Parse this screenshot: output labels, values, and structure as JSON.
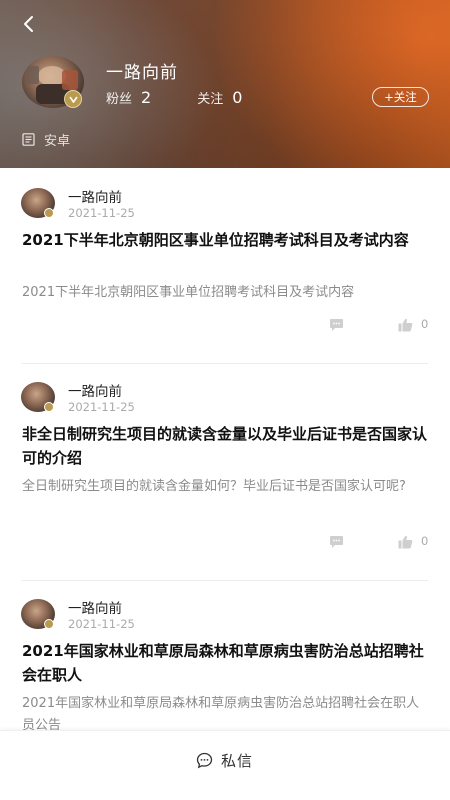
{
  "profile": {
    "name": "一路向前",
    "fans_label": "粉丝",
    "fans_count": "2",
    "following_label": "关注",
    "following_count": "0",
    "follow_button": "+关注",
    "platform": "安卓"
  },
  "posts": [
    {
      "author": "一路向前",
      "date": "2021-11-25",
      "title": "2021下半年北京朝阳区事业单位招聘考试科目及考试内容",
      "summary": "2021下半年北京朝阳区事业单位招聘考试科目及考试内容",
      "likes": "0"
    },
    {
      "author": "一路向前",
      "date": "2021-11-25",
      "title": "非全日制研究生项目的就读含金量以及毕业后证书是否国家认可的介绍",
      "summary": "全日制研究生项目的就读含金量如何？毕业后证书是否国家认可呢?",
      "likes": "0"
    },
    {
      "author": "一路向前",
      "date": "2021-11-25",
      "title": "2021年国家林业和草原局森林和草原病虫害防治总站招聘社会在职人",
      "summary": "2021年国家林业和草原局森林和草原病虫害防治总站招聘社会在职人员公告"
    }
  ],
  "bottom_bar": {
    "message_label": "私信"
  },
  "icons": {
    "back": "back-arrow-icon",
    "platform": "document-icon",
    "comment": "comment-icon",
    "like": "thumbs-up-icon",
    "message": "chat-bubble-icon"
  },
  "colors": {
    "header_start": "#6f5c52",
    "header_end": "#b4561f",
    "title_text": "#111111",
    "summary_text": "#8b8b8b",
    "meta_text": "#aaaaaa"
  }
}
